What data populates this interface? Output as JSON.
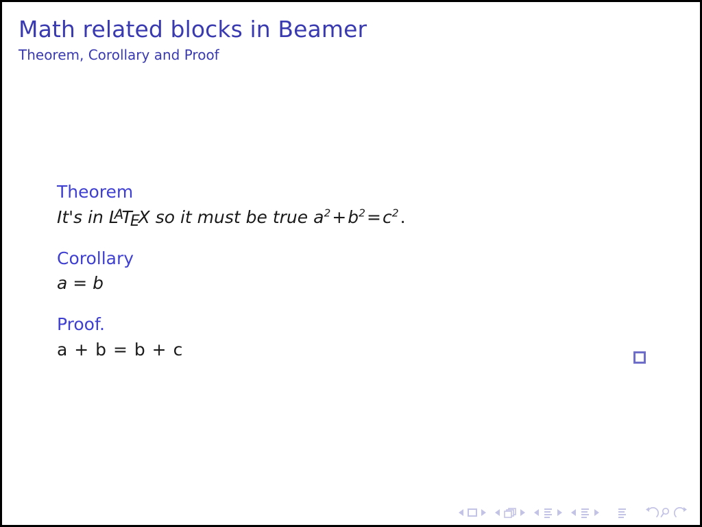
{
  "slide": {
    "title": "Math related blocks in Beamer",
    "subtitle": "Theorem, Corollary and Proof",
    "title_color": "#3a3ab0",
    "block_title_color": "#4040d0",
    "body_color": "#1a1a1a",
    "background_color": "#ffffff",
    "border_color": "#000000",
    "nav_color": "#c3c3e6",
    "qed_border_color": "#6e6ec8"
  },
  "blocks": [
    {
      "title": "Theorem",
      "body_prefix": "It's in ",
      "latex_logo": {
        "l": "L",
        "a": "A",
        "t": "T",
        "e": "E",
        "x": "X"
      },
      "body_middle": " so it must be true ",
      "math": {
        "a": "a",
        "a_exp": "2",
        "plus": "+",
        "b": "b",
        "b_exp": "2",
        "equals": "=",
        "c": "c",
        "c_exp": "2",
        "period": "."
      },
      "style": "italic"
    },
    {
      "title": "Corollary",
      "body": "a = b",
      "style": "italic"
    },
    {
      "title": "Proof.",
      "body": "a + b = b + c",
      "style": "upright",
      "qed": true
    }
  ],
  "navigation": {
    "items": [
      {
        "name": "slide",
        "label": "slide"
      },
      {
        "name": "frame",
        "label": "frame"
      },
      {
        "name": "subsection",
        "label": "subsection"
      },
      {
        "name": "section",
        "label": "section"
      },
      {
        "name": "presentation",
        "label": "presentation"
      },
      {
        "name": "back",
        "label": "back"
      },
      {
        "name": "search",
        "label": "find"
      },
      {
        "name": "forward",
        "label": "forward"
      }
    ]
  }
}
